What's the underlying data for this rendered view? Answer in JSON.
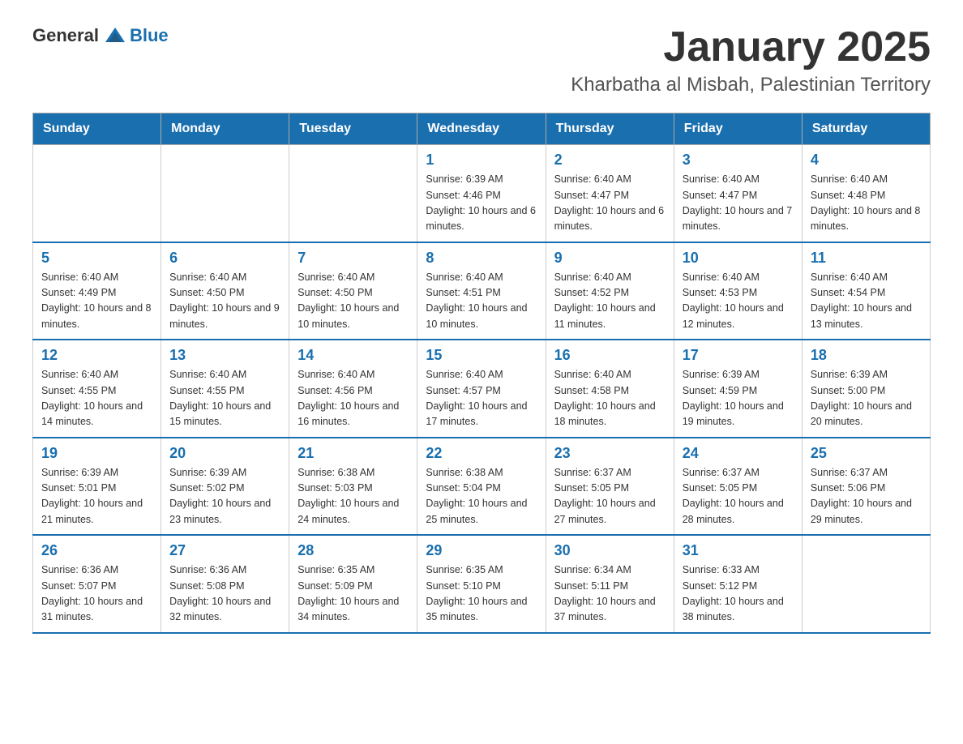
{
  "logo": {
    "general": "General",
    "blue": "Blue"
  },
  "title": "January 2025",
  "location": "Kharbatha al Misbah, Palestinian Territory",
  "weekdays": [
    "Sunday",
    "Monday",
    "Tuesday",
    "Wednesday",
    "Thursday",
    "Friday",
    "Saturday"
  ],
  "weeks": [
    [
      {
        "day": "",
        "info": ""
      },
      {
        "day": "",
        "info": ""
      },
      {
        "day": "",
        "info": ""
      },
      {
        "day": "1",
        "info": "Sunrise: 6:39 AM\nSunset: 4:46 PM\nDaylight: 10 hours and 6 minutes."
      },
      {
        "day": "2",
        "info": "Sunrise: 6:40 AM\nSunset: 4:47 PM\nDaylight: 10 hours and 6 minutes."
      },
      {
        "day": "3",
        "info": "Sunrise: 6:40 AM\nSunset: 4:47 PM\nDaylight: 10 hours and 7 minutes."
      },
      {
        "day": "4",
        "info": "Sunrise: 6:40 AM\nSunset: 4:48 PM\nDaylight: 10 hours and 8 minutes."
      }
    ],
    [
      {
        "day": "5",
        "info": "Sunrise: 6:40 AM\nSunset: 4:49 PM\nDaylight: 10 hours and 8 minutes."
      },
      {
        "day": "6",
        "info": "Sunrise: 6:40 AM\nSunset: 4:50 PM\nDaylight: 10 hours and 9 minutes."
      },
      {
        "day": "7",
        "info": "Sunrise: 6:40 AM\nSunset: 4:50 PM\nDaylight: 10 hours and 10 minutes."
      },
      {
        "day": "8",
        "info": "Sunrise: 6:40 AM\nSunset: 4:51 PM\nDaylight: 10 hours and 10 minutes."
      },
      {
        "day": "9",
        "info": "Sunrise: 6:40 AM\nSunset: 4:52 PM\nDaylight: 10 hours and 11 minutes."
      },
      {
        "day": "10",
        "info": "Sunrise: 6:40 AM\nSunset: 4:53 PM\nDaylight: 10 hours and 12 minutes."
      },
      {
        "day": "11",
        "info": "Sunrise: 6:40 AM\nSunset: 4:54 PM\nDaylight: 10 hours and 13 minutes."
      }
    ],
    [
      {
        "day": "12",
        "info": "Sunrise: 6:40 AM\nSunset: 4:55 PM\nDaylight: 10 hours and 14 minutes."
      },
      {
        "day": "13",
        "info": "Sunrise: 6:40 AM\nSunset: 4:55 PM\nDaylight: 10 hours and 15 minutes."
      },
      {
        "day": "14",
        "info": "Sunrise: 6:40 AM\nSunset: 4:56 PM\nDaylight: 10 hours and 16 minutes."
      },
      {
        "day": "15",
        "info": "Sunrise: 6:40 AM\nSunset: 4:57 PM\nDaylight: 10 hours and 17 minutes."
      },
      {
        "day": "16",
        "info": "Sunrise: 6:40 AM\nSunset: 4:58 PM\nDaylight: 10 hours and 18 minutes."
      },
      {
        "day": "17",
        "info": "Sunrise: 6:39 AM\nSunset: 4:59 PM\nDaylight: 10 hours and 19 minutes."
      },
      {
        "day": "18",
        "info": "Sunrise: 6:39 AM\nSunset: 5:00 PM\nDaylight: 10 hours and 20 minutes."
      }
    ],
    [
      {
        "day": "19",
        "info": "Sunrise: 6:39 AM\nSunset: 5:01 PM\nDaylight: 10 hours and 21 minutes."
      },
      {
        "day": "20",
        "info": "Sunrise: 6:39 AM\nSunset: 5:02 PM\nDaylight: 10 hours and 23 minutes."
      },
      {
        "day": "21",
        "info": "Sunrise: 6:38 AM\nSunset: 5:03 PM\nDaylight: 10 hours and 24 minutes."
      },
      {
        "day": "22",
        "info": "Sunrise: 6:38 AM\nSunset: 5:04 PM\nDaylight: 10 hours and 25 minutes."
      },
      {
        "day": "23",
        "info": "Sunrise: 6:37 AM\nSunset: 5:05 PM\nDaylight: 10 hours and 27 minutes."
      },
      {
        "day": "24",
        "info": "Sunrise: 6:37 AM\nSunset: 5:05 PM\nDaylight: 10 hours and 28 minutes."
      },
      {
        "day": "25",
        "info": "Sunrise: 6:37 AM\nSunset: 5:06 PM\nDaylight: 10 hours and 29 minutes."
      }
    ],
    [
      {
        "day": "26",
        "info": "Sunrise: 6:36 AM\nSunset: 5:07 PM\nDaylight: 10 hours and 31 minutes."
      },
      {
        "day": "27",
        "info": "Sunrise: 6:36 AM\nSunset: 5:08 PM\nDaylight: 10 hours and 32 minutes."
      },
      {
        "day": "28",
        "info": "Sunrise: 6:35 AM\nSunset: 5:09 PM\nDaylight: 10 hours and 34 minutes."
      },
      {
        "day": "29",
        "info": "Sunrise: 6:35 AM\nSunset: 5:10 PM\nDaylight: 10 hours and 35 minutes."
      },
      {
        "day": "30",
        "info": "Sunrise: 6:34 AM\nSunset: 5:11 PM\nDaylight: 10 hours and 37 minutes."
      },
      {
        "day": "31",
        "info": "Sunrise: 6:33 AM\nSunset: 5:12 PM\nDaylight: 10 hours and 38 minutes."
      },
      {
        "day": "",
        "info": ""
      }
    ]
  ]
}
